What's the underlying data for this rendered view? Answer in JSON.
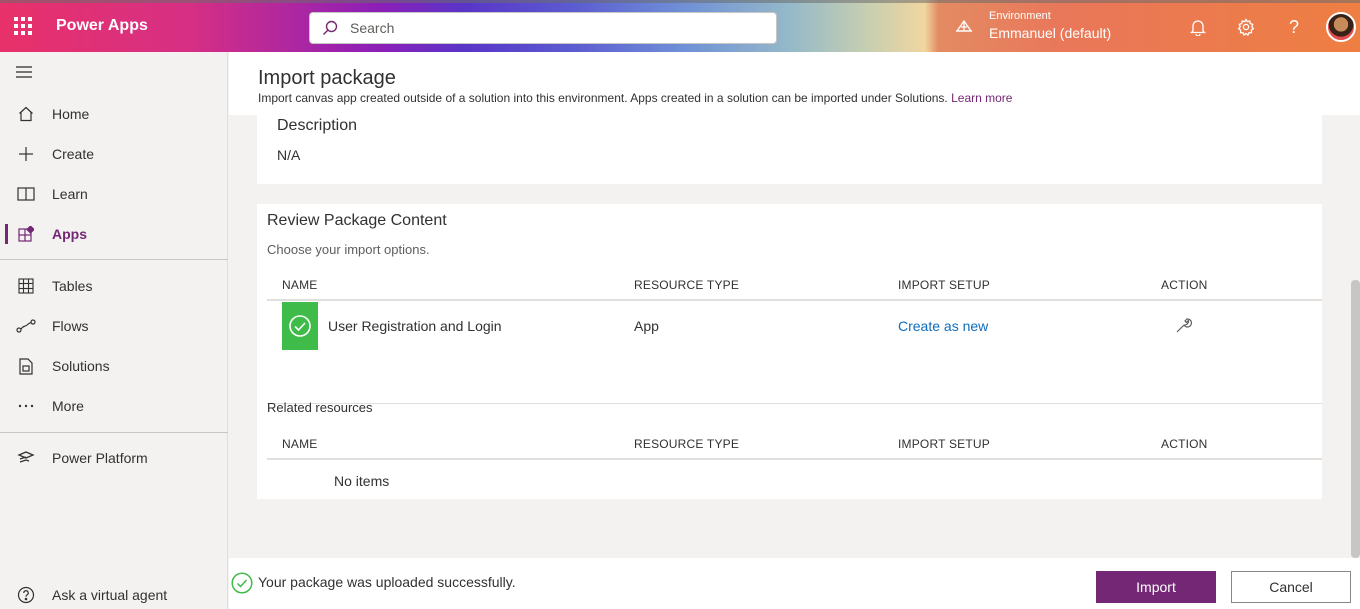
{
  "app": {
    "name": "Power Apps"
  },
  "search": {
    "placeholder": "Search"
  },
  "environment": {
    "label": "Environment",
    "name": "Emmanuel (default)"
  },
  "nav": {
    "items": [
      {
        "label": "Home",
        "icon": "home-icon"
      },
      {
        "label": "Create",
        "icon": "plus-icon"
      },
      {
        "label": "Learn",
        "icon": "book-icon"
      },
      {
        "label": "Apps",
        "icon": "apps-icon",
        "active": true
      },
      {
        "label": "Tables",
        "icon": "table-icon"
      },
      {
        "label": "Flows",
        "icon": "flow-icon"
      },
      {
        "label": "Solutions",
        "icon": "solution-icon"
      },
      {
        "label": "More",
        "icon": "ellipsis-icon"
      },
      {
        "label": "Power Platform",
        "icon": "power-platform-icon"
      },
      {
        "label": "Ask a virtual agent",
        "icon": "help-circle-icon"
      }
    ]
  },
  "page": {
    "title": "Import package",
    "subtitle": "Import canvas app created outside of a solution into this environment. Apps created in a solution can be imported under Solutions.",
    "learn_more": "Learn more"
  },
  "description": {
    "title": "Description",
    "value": "N/A"
  },
  "review": {
    "title": "Review Package Content",
    "subtitle": "Choose your import options.",
    "columns": [
      "NAME",
      "RESOURCE TYPE",
      "IMPORT SETUP",
      "ACTION"
    ],
    "rows": [
      {
        "name": "User Registration and Login",
        "type": "App",
        "setup": "Create as new",
        "action_icon": "wrench-icon"
      }
    ]
  },
  "related": {
    "title": "Related resources",
    "columns": [
      "NAME",
      "RESOURCE TYPE",
      "IMPORT SETUP",
      "ACTION"
    ],
    "empty": "No items"
  },
  "footer": {
    "message": "Your package was uploaded successfully.",
    "import_label": "Import",
    "cancel_label": "Cancel"
  },
  "colors": {
    "accent": "#742774",
    "success": "#3fbb4a",
    "link": "#0f6cbd"
  }
}
